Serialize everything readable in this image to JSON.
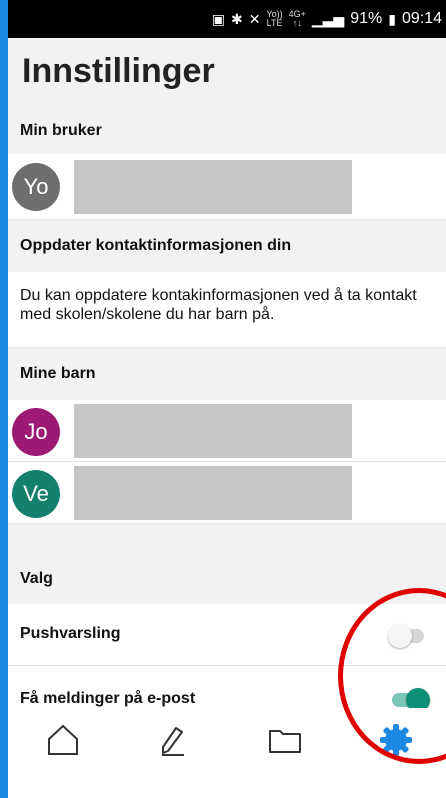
{
  "status_bar": {
    "network_top": "Yo))",
    "network_bottom": "LTE",
    "signal_top": "4G+",
    "signal_bottom": "↑↓",
    "battery": "91%",
    "time": "09:14"
  },
  "page": {
    "title": "Innstillinger"
  },
  "sections": {
    "my_user": "Min bruker",
    "update_contact": "Oppdater kontaktinformasjonen din",
    "my_children": "Mine barn",
    "options": "Valg"
  },
  "user": {
    "initials": "Yo",
    "avatar_color": "#6e6e6e"
  },
  "info_text": "Du kan oppdatere kontakinformasjonen ved å ta kontakt med skolen/skolene du har barn på.",
  "children": [
    {
      "initials": "Jo",
      "avatar_color": "#9c1a74"
    },
    {
      "initials": "Ve",
      "avatar_color": "#13806e"
    }
  ],
  "settings": [
    {
      "label": "Pushvarsling",
      "enabled": false
    },
    {
      "label": "Få meldinger på e-post",
      "enabled": true
    }
  ],
  "nav": [
    "home-icon",
    "edit-icon",
    "folder-icon",
    "settings-icon"
  ],
  "colors": {
    "accent": "#1e88e5",
    "toggle_on": "#0e8f78",
    "toggle_off": "#d6d6d6",
    "highlight": "#e00000"
  }
}
